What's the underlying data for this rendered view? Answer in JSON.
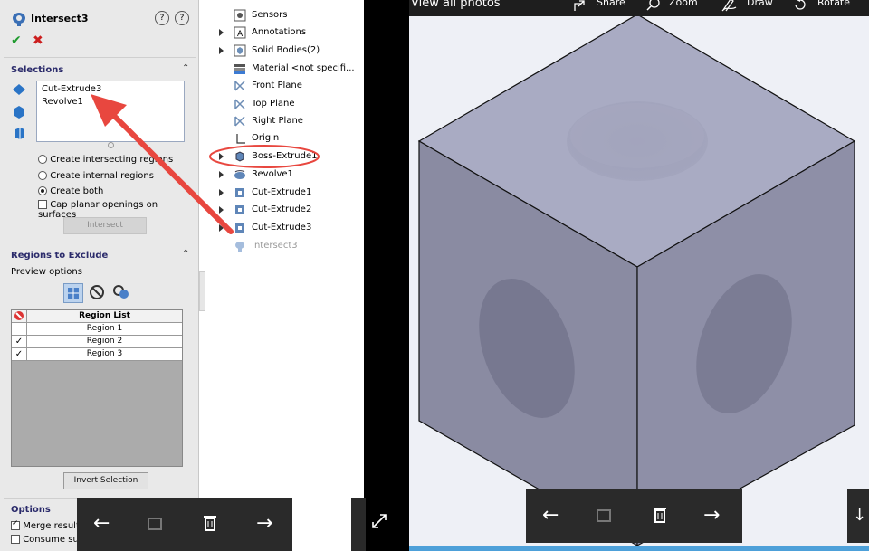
{
  "property_manager": {
    "title": "Intersect3",
    "selections_label": "Selections",
    "selections_list": [
      "Cut-Extrude3",
      "Revolve1"
    ],
    "options_radios": [
      {
        "label": "Create intersecting regions",
        "selected": false
      },
      {
        "label": "Create internal regions",
        "selected": false
      },
      {
        "label": "Create both",
        "selected": true
      }
    ],
    "cap_label": "Cap planar openings on surfaces",
    "intersect_button": "Intersect",
    "regions_label": "Regions to Exclude",
    "preview_label": "Preview options",
    "region_header": "Region List",
    "regions": [
      {
        "name": "Region  1",
        "checked": false
      },
      {
        "name": "Region  2",
        "checked": true
      },
      {
        "name": "Region  3",
        "checked": true
      }
    ],
    "invert_button": "Invert Selection",
    "options_label": "Options",
    "merge_label": "Merge result",
    "consume_label": "Consume surfaces"
  },
  "tree": {
    "items": [
      {
        "label": "Sensors"
      },
      {
        "label": "Annotations"
      },
      {
        "label": "Solid Bodies(2)"
      },
      {
        "label": "Material <not specifi..."
      },
      {
        "label": "Front Plane"
      },
      {
        "label": "Top Plane"
      },
      {
        "label": "Right Plane"
      },
      {
        "label": "Origin"
      },
      {
        "label": "Boss-Extrude1"
      },
      {
        "label": "Revolve1"
      },
      {
        "label": "Cut-Extrude1"
      },
      {
        "label": "Cut-Extrude2"
      },
      {
        "label": "Cut-Extrude3"
      },
      {
        "label": "Intersect3"
      }
    ]
  },
  "viewer": {
    "view_all": "View all photos",
    "share": "Share",
    "zoom": "Zoom",
    "draw": "Draw",
    "rotate": "Rotate"
  },
  "colors": {
    "highlight_red": "#e8473f",
    "annotation_arrow": "#e8473f",
    "cube_top": "#a9abc3",
    "cube_left": "#8a8ba2",
    "cube_right": "#8e8fa7"
  }
}
